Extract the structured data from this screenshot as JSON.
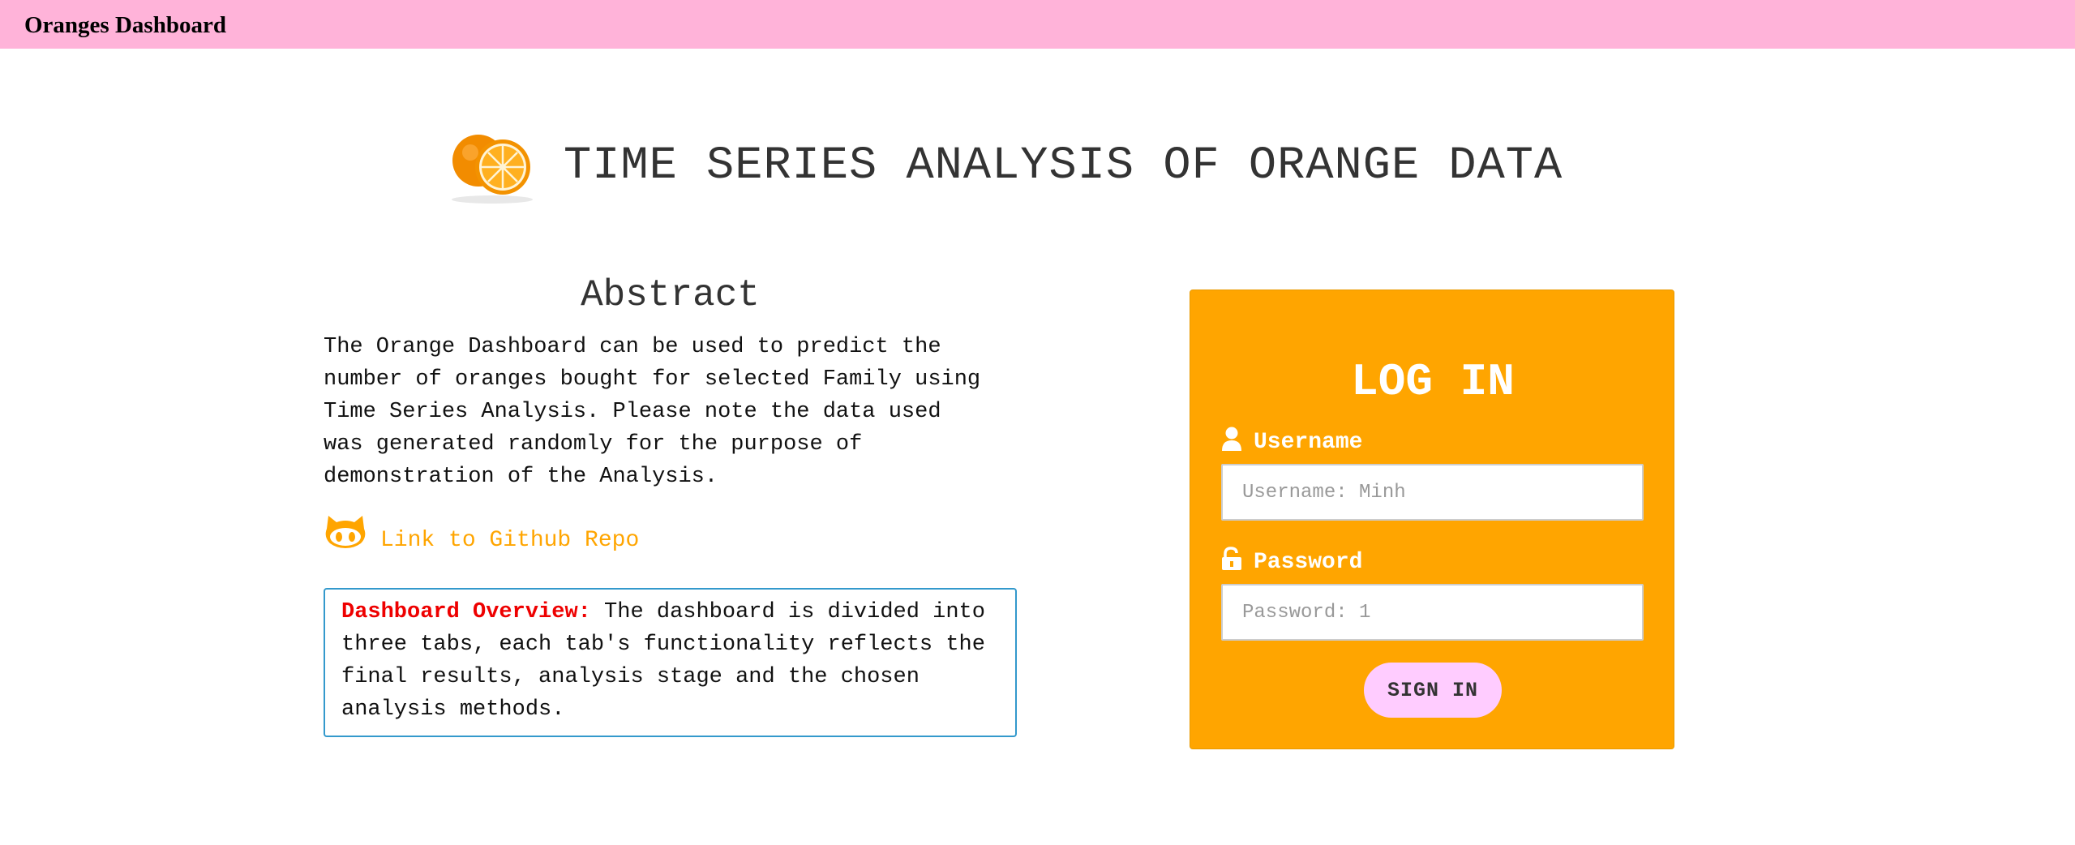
{
  "navbar": {
    "brand": "Oranges Dashboard"
  },
  "header": {
    "title": "TIME SERIES ANALYSIS OF ORANGE DATA",
    "icon": "orange-icon"
  },
  "abstract": {
    "heading": "Abstract",
    "text": "The Orange Dashboard can be used to predict the\nnumber of oranges bought for selected Family using\nTime Series Analysis. Please note the data used\nwas generated randomly for the purpose of\ndemonstration of the Analysis.",
    "github_link_text": "Link to Github Repo",
    "github_icon": "github-icon"
  },
  "overview": {
    "label": "Dashboard Overview:",
    "text": " The dashboard is divided into three tabs, each tab's functionality reflects the final results, analysis stage and the chosen analysis methods."
  },
  "login": {
    "title": "LOG IN",
    "username_label": "Username",
    "username_icon": "user-icon",
    "username_placeholder": "Username: Minh",
    "password_label": "Password",
    "password_icon": "unlock-icon",
    "password_placeholder": "Password: 1",
    "signin_label": "SIGN IN"
  },
  "colors": {
    "navbar_bg": "#ffb3d9",
    "accent_orange": "#ffa500",
    "overview_border": "#3399cc",
    "overview_label": "#ee0000",
    "signin_bg": "#ffccff"
  }
}
